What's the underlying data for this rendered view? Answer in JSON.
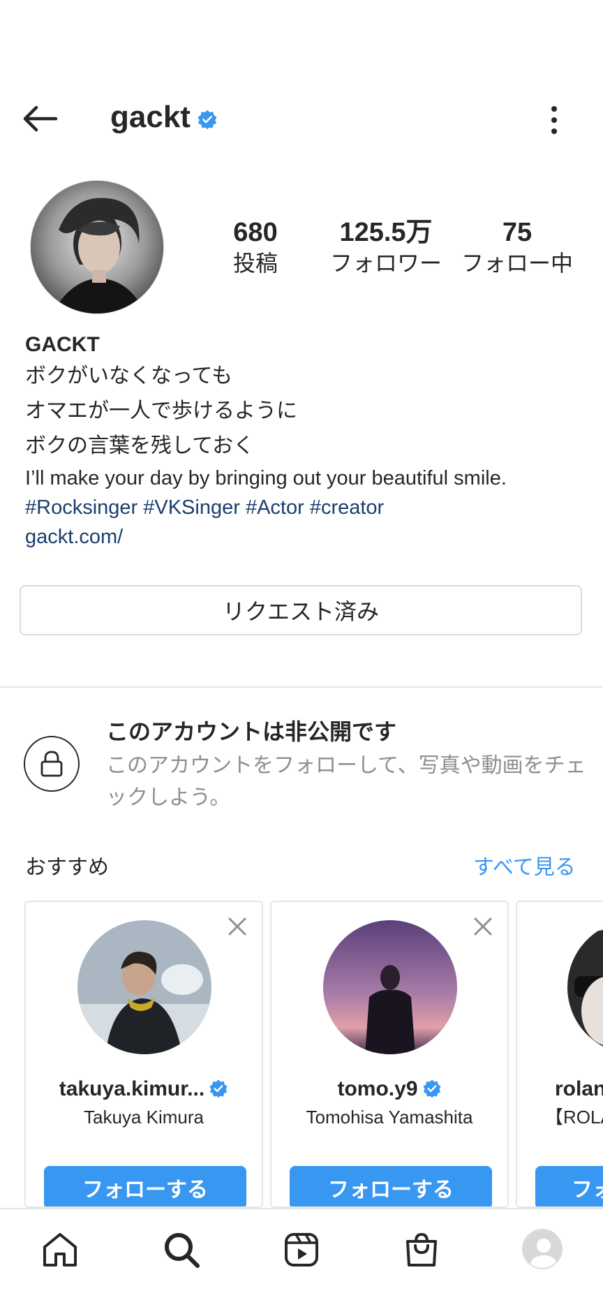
{
  "header": {
    "username": "gackt",
    "verified": true
  },
  "stats": [
    {
      "value": "680",
      "label": "投稿"
    },
    {
      "value": "125.5万",
      "label": "フォロワー"
    },
    {
      "value": "75",
      "label": "フォロー中"
    }
  ],
  "bio": {
    "name": "GACKT",
    "lines": [
      "ボクがいなくなっても",
      "オマエが一人で歩けるように",
      "ボクの言葉を残しておく"
    ],
    "english": "I’ll make your day by bringing out your beautiful smile.",
    "hashtags": "#Rocksinger #VKSinger #Actor #creator",
    "link": "gackt.com/"
  },
  "request_button": "リクエスト済み",
  "private": {
    "title": "このアカウントは非公開です",
    "description": "このアカウントをフォローして、写真や動画をチェックしよう。"
  },
  "recommendations": {
    "title": "おすすめ",
    "see_all": "すべて見る",
    "items": [
      {
        "username": "takuya.kimur...",
        "name": "Takuya Kimura",
        "verified": true,
        "follow": "フォローする"
      },
      {
        "username": "tomo.y9",
        "name": "Tomohisa Yamashita",
        "verified": true,
        "follow": "フォローする"
      },
      {
        "username": "rolan",
        "name": "【ROLAN",
        "verified": false,
        "follow": "フォ"
      }
    ]
  },
  "colors": {
    "accent": "#3897f0",
    "link": "#1a3e6e",
    "muted": "#8e8e8e"
  },
  "nav": [
    "home-icon",
    "search-icon",
    "reels-icon",
    "shop-icon",
    "profile-icon"
  ]
}
